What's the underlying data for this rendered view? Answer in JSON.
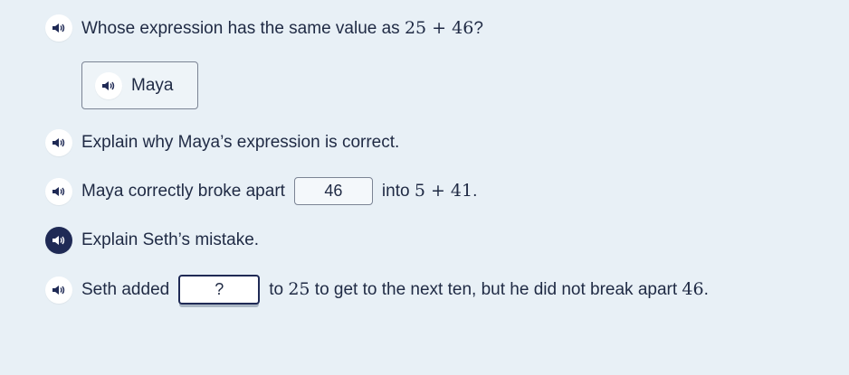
{
  "icons": {
    "speaker": "speaker-icon"
  },
  "colors": {
    "background": "#e8f0f6",
    "text": "#1f2a44",
    "active_speaker": "#1f2a55"
  },
  "question": {
    "prefix": "Whose expression has the same value as ",
    "expr": "25 + 46",
    "suffix": "?"
  },
  "choice": {
    "label": "Maya"
  },
  "prompt1": {
    "text": "Explain why Maya’s expression is correct."
  },
  "line1": {
    "prefix": "Maya correctly broke apart",
    "answer": "46",
    "middle": "into ",
    "expr": "5 + 41",
    "suffix": "."
  },
  "prompt2": {
    "text": "Explain Seth’s mistake."
  },
  "line2": {
    "prefix": "Seth added",
    "answer": "?",
    "middle": "to ",
    "num1": "25",
    "after": " to get to the next ten, but he did not break apart ",
    "num2": "46",
    "suffix": "."
  }
}
